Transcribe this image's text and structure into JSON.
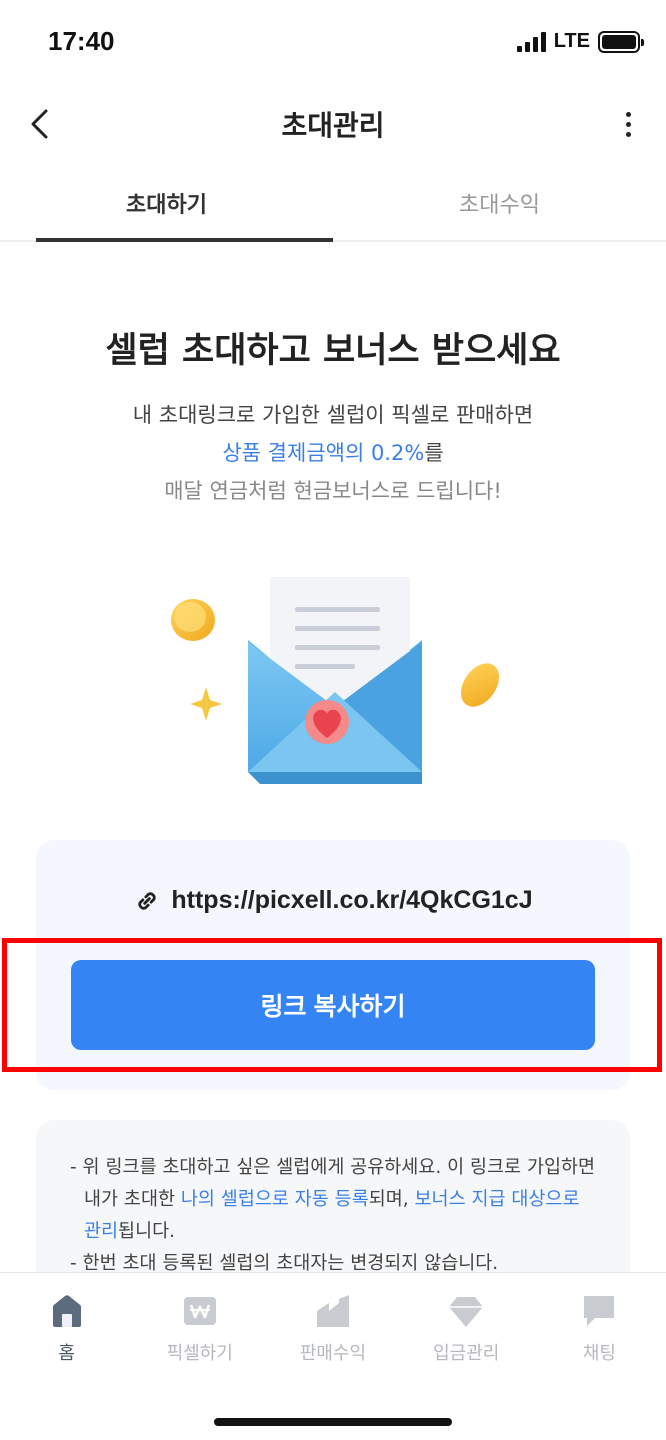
{
  "status_bar": {
    "time": "17:40",
    "network": "LTE"
  },
  "header": {
    "title": "초대관리"
  },
  "tabs": [
    {
      "label": "초대하기",
      "active": true
    },
    {
      "label": "초대수익",
      "active": false
    }
  ],
  "hero": {
    "headline": "셀럽 초대하고 보너스 받으세요",
    "line1": "내 초대링크로 가입한 셀럽이 픽셀로 판매하면",
    "line2_highlight": "상품 결제금액의 0.2%",
    "line2_rest": "를",
    "line3": "매달 연금처럼 현금보너스로 드립니다!"
  },
  "link_card": {
    "url": "https://picxell.co.kr/4QkCG1cJ",
    "copy_label": "링크 복사하기"
  },
  "info": {
    "l1_a": "- 위 링크를 초대하고 싶은 셀럽에게 공유하세요. 이 링크로 가입하면 내가 초대한 ",
    "l1_b": "나의 셀럽으로 자동 등록",
    "l1_c": "되며, ",
    "l1_d": "보너스 지급 대상으로 관리",
    "l1_e": "됩니다.",
    "l2": "- 한번 초대 등록된 셀럽의 초대자는 변경되지 않습니다."
  },
  "bottom_nav": [
    {
      "label": "홈",
      "icon": "home-icon",
      "active": true
    },
    {
      "label": "픽셀하기",
      "icon": "won-card-icon",
      "active": false
    },
    {
      "label": "판매수익",
      "icon": "sales-icon",
      "active": false
    },
    {
      "label": "입금관리",
      "icon": "diamond-icon",
      "active": false
    },
    {
      "label": "채팅",
      "icon": "chat-icon",
      "active": false
    }
  ],
  "colors": {
    "accent": "#3485f3",
    "highlight_text": "#3a7fe6",
    "annotation": "#ff0000"
  }
}
